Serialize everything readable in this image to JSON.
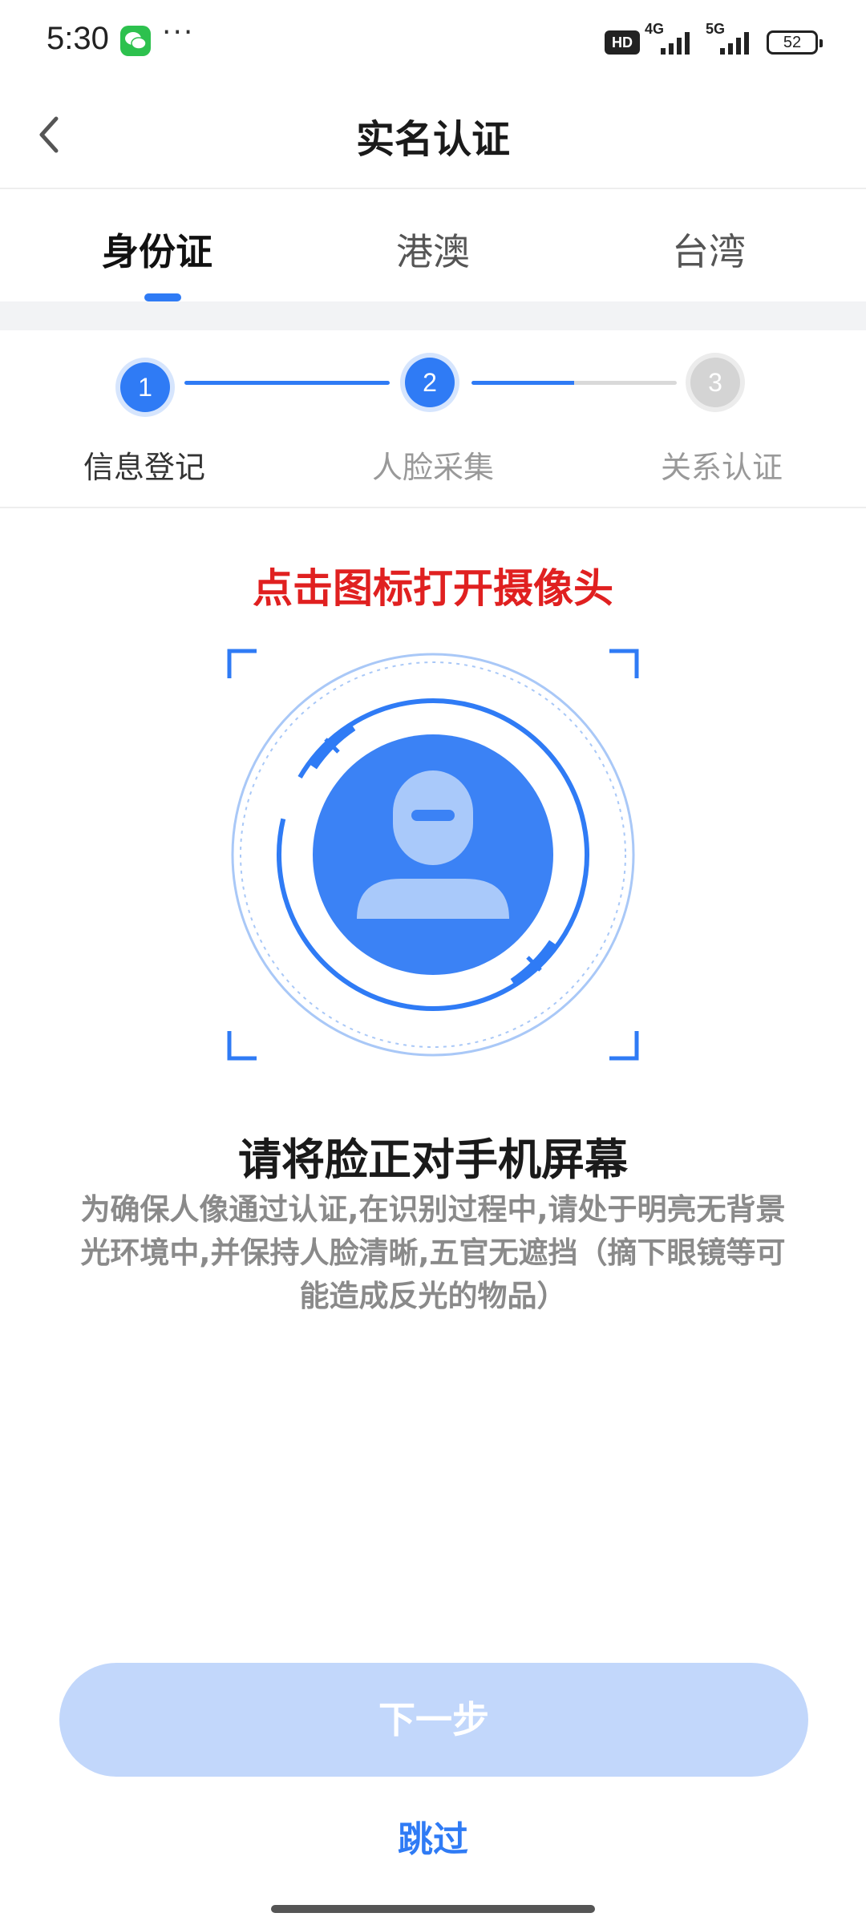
{
  "status_bar": {
    "time": "5:30",
    "more": "···",
    "hd_badge": "HD",
    "network_1": "4G",
    "network_2": "5G",
    "battery": "52"
  },
  "nav": {
    "title": "实名认证"
  },
  "tabs": [
    {
      "label": "身份证",
      "active": true
    },
    {
      "label": "港澳",
      "active": false
    },
    {
      "label": "台湾",
      "active": false
    }
  ],
  "steps": [
    {
      "number": "1",
      "label": "信息登记",
      "state": "done"
    },
    {
      "number": "2",
      "label": "人脸采集",
      "state": "current"
    },
    {
      "number": "3",
      "label": "关系认证",
      "state": "pending"
    }
  ],
  "main": {
    "camera_hint": "点击图标打开摄像头",
    "instruction_title": "请将脸正对手机屏幕",
    "instruction_text": "为确保人像通过认证,在识别过程中,请处于明亮无背景光环境中,并保持人脸清晰,五官无遮挡（摘下眼镜等可能造成反光的物品）"
  },
  "actions": {
    "next_label": "下一步",
    "skip_label": "跳过"
  },
  "colors": {
    "accent": "#2f7bf5",
    "hint_red": "#e02020",
    "button_disabled": "#c2d7fb"
  }
}
